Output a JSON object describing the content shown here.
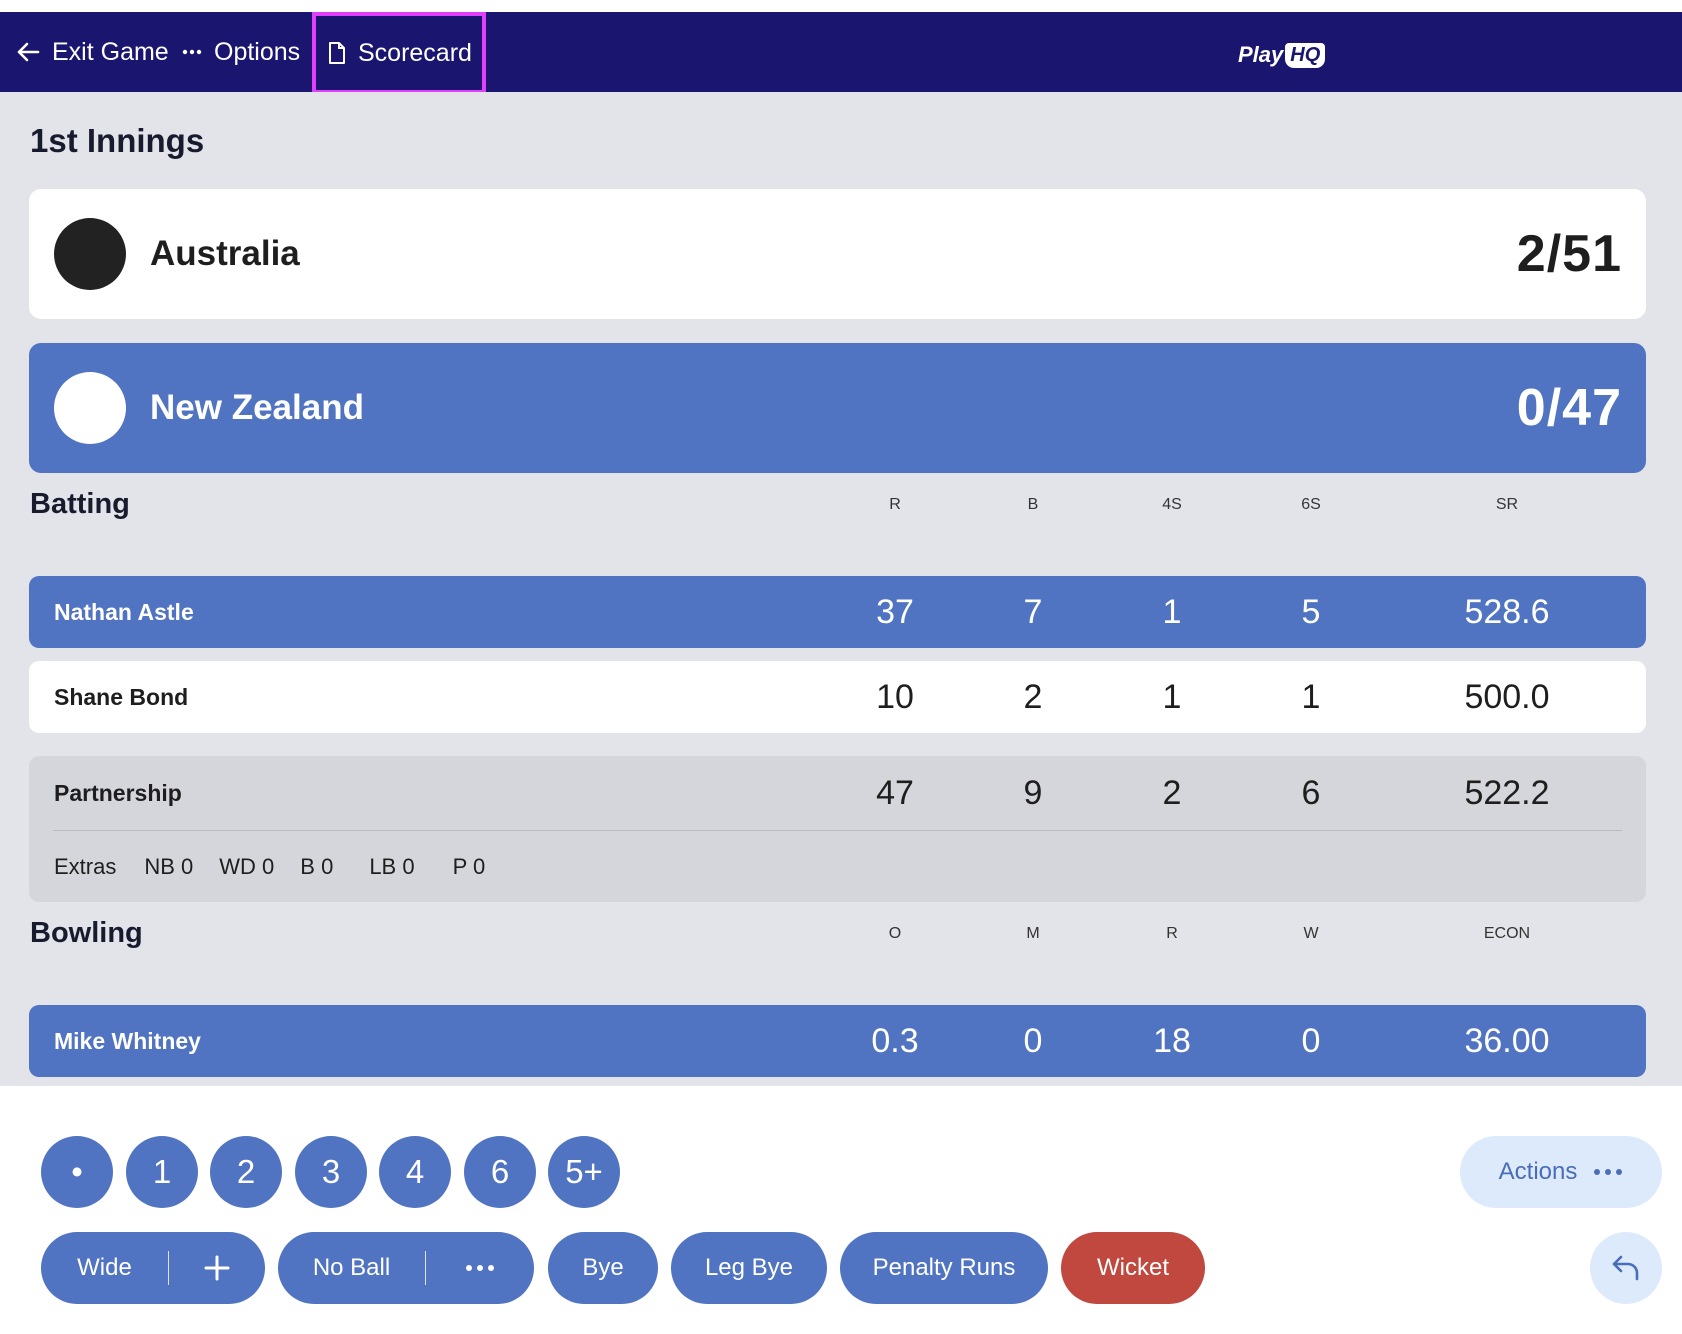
{
  "header": {
    "exit_label": "Exit Game",
    "options_label": "Options",
    "scorecard_label": "Scorecard",
    "logo_play": "Play",
    "logo_hq": "HQ"
  },
  "innings": {
    "title": "1st Innings"
  },
  "teams": [
    {
      "name": "Australia",
      "score": "2/51"
    },
    {
      "name": "New Zealand",
      "score": "0/47"
    }
  ],
  "batting": {
    "title": "Batting",
    "columns": [
      "R",
      "B",
      "4S",
      "6S",
      "SR"
    ],
    "rows": [
      {
        "name": "Nathan Astle",
        "r": "37",
        "b": "7",
        "fours": "1",
        "sixes": "5",
        "sr": "528.6"
      },
      {
        "name": "Shane Bond",
        "r": "10",
        "b": "2",
        "fours": "1",
        "sixes": "1",
        "sr": "500.0"
      }
    ],
    "partnership": {
      "name": "Partnership",
      "r": "47",
      "b": "9",
      "fours": "2",
      "sixes": "6",
      "sr": "522.2"
    },
    "extras": {
      "label": "Extras",
      "nb": "NB 0",
      "wd": "WD 0",
      "b": "B 0",
      "lb": "LB 0",
      "p": "P 0"
    }
  },
  "bowling": {
    "title": "Bowling",
    "columns": [
      "O",
      "M",
      "R",
      "W",
      "ECON"
    ],
    "rows": [
      {
        "name": "Mike Whitney",
        "o": "0.3",
        "m": "0",
        "r": "18",
        "w": "0",
        "econ": "36.00"
      }
    ]
  },
  "controls": {
    "runs": [
      "•",
      "1",
      "2",
      "3",
      "4",
      "6",
      "5+"
    ],
    "wide": "Wide",
    "no_ball": "No Ball",
    "bye": "Bye",
    "leg_bye": "Leg Bye",
    "penalty": "Penalty Runs",
    "wicket": "Wicket",
    "actions": "Actions"
  },
  "colors": {
    "header_bg": "#1a1670",
    "accent_blue": "#5074c1",
    "wicket_red": "#c0483e",
    "highlight": "#e040fb"
  }
}
